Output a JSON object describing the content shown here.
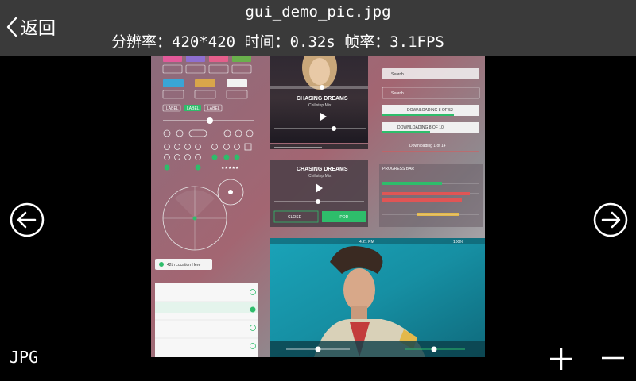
{
  "topbar": {
    "back_label": "返回",
    "filename": "gui_demo_pic.jpg",
    "resolution_label": "分辨率：",
    "resolution_value": "420*420",
    "time_label": "时间：",
    "time_value": "0.32s",
    "fps_label": "帧率：",
    "fps_value": "3.1FPS"
  },
  "footer": {
    "format": "JPG"
  },
  "image_content": {
    "player_title": "CHASING DREAMS",
    "player_subtitle": "Chillstep Mix",
    "player2_title": "CHASING DREAMS",
    "player2_subtitle": "Chillstep Mix",
    "close_label": "CLOSE",
    "ipod_label": "IPOD",
    "search_placeholder": "Search",
    "downloading_label": "DOWNLOADING 8 OF 52",
    "unavailable_label": "DOWNLOADING 8 OF 10",
    "downloading_of": "Downloading 1 of 14",
    "progress_label": "PROGRESS BAR",
    "location_label": "42th Location Here",
    "tags": [
      "LABEL",
      "LABEL",
      "LABEL"
    ],
    "time_left": "4:21 PM",
    "battery": "100%"
  },
  "icons": {
    "back": "chevron-left-icon",
    "prev": "circle-arrow-left-icon",
    "next": "circle-arrow-right-icon",
    "zoom_in": "plus-icon",
    "zoom_out": "minus-icon"
  },
  "colors": {
    "topbar_bg": "#3a3a3a",
    "accent_green": "#2ebd6b"
  }
}
